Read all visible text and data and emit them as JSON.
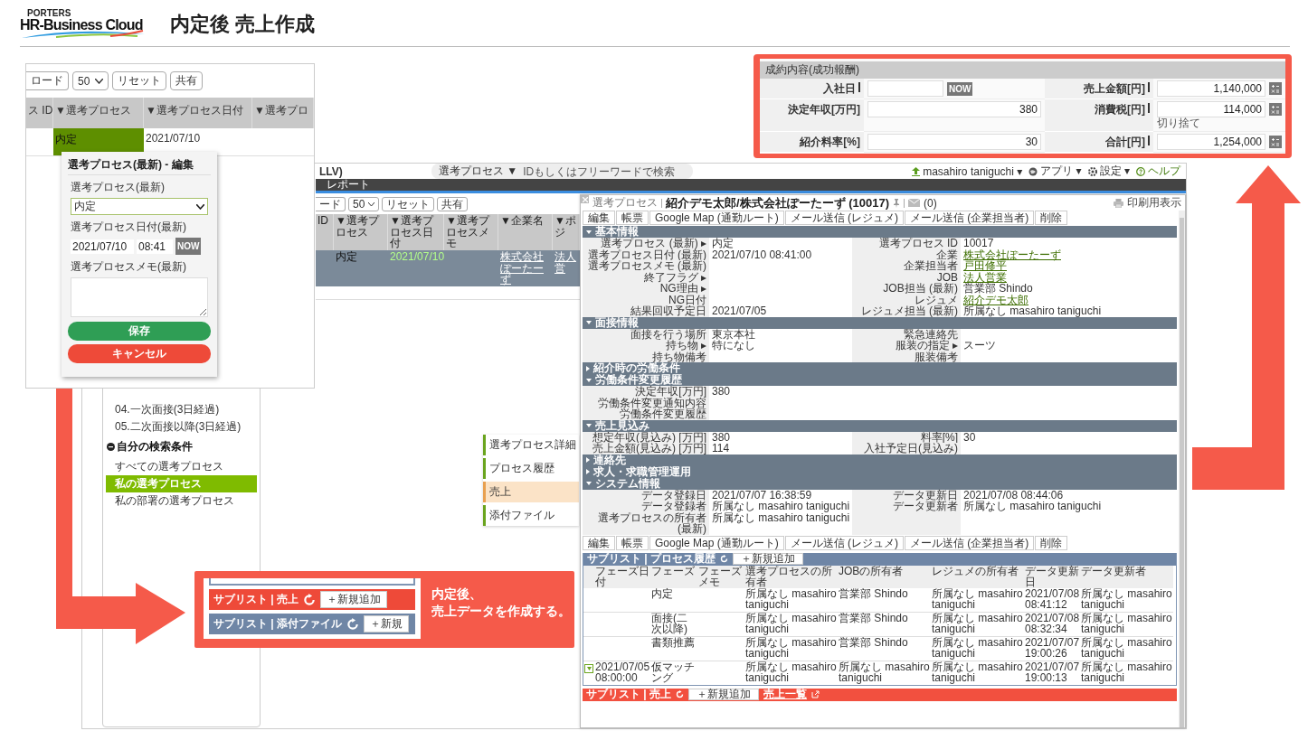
{
  "header": {
    "brand_top": "PORTERS",
    "brand": "HR-Business Cloud",
    "title": "内定後 売上作成"
  },
  "list_panel": {
    "toolbar": [
      {
        "kind": "button",
        "label": "ロード"
      },
      {
        "kind": "select",
        "label": "50"
      },
      {
        "kind": "button",
        "label": "リセット"
      },
      {
        "kind": "button",
        "label": "共有"
      }
    ],
    "columns": [
      "ス ID",
      "▼選考プロセス",
      "▼選考プロセス日付",
      "▼選考プロ"
    ],
    "row": {
      "process": "内定",
      "date": "2021/07/10"
    },
    "popup": {
      "title": "選考プロセス(最新) - 編集",
      "process_label": "選考プロセス(最新)",
      "process_value": "内定",
      "date_label": "選考プロセス日付(最新)",
      "date_value": "2021/07/10",
      "time_value": "08:41",
      "now_button": "NOW",
      "memo_label": "選考プロセスメモ(最新)",
      "save_button": "保存",
      "cancel_button": "キャンセル"
    }
  },
  "app": {
    "title_fragment": "LLV)",
    "search": {
      "scope": "選考プロセス ▼",
      "placeholder": "IDもしくはフリーワードで検索"
    },
    "user_menu": [
      {
        "kind": "user",
        "label": "masahiro taniguchi ▾"
      },
      {
        "kind": "apps",
        "label": "アプリ ▾"
      },
      {
        "kind": "settings",
        "label": "設定 ▾"
      },
      {
        "kind": "help",
        "label": "ヘルプ"
      }
    ],
    "menu": [
      "レポート"
    ],
    "toolbar": [
      {
        "kind": "button",
        "label": "ード"
      },
      {
        "kind": "select",
        "label": "50"
      },
      {
        "kind": "button",
        "label": "リセット"
      },
      {
        "kind": "button",
        "label": "共有"
      }
    ],
    "columns": [
      "ID",
      "▼選考プロセス",
      "▼選考プロセス日付",
      "▼選考プロセスメモ",
      "▼企業名",
      "▼ポジ"
    ],
    "row": {
      "process": "内定",
      "date": "2021/07/10",
      "company": "株式会社ぽーたーず",
      "position": "法人営"
    },
    "sidebar": {
      "groups": [
        {
          "items": [
            {
              "label": "04.一次面接(3日経過)",
              "selected": false
            },
            {
              "label": "05.二次面接以降(3日経過)",
              "selected": false
            }
          ]
        },
        {
          "heading": "自分の検索条件",
          "items": [
            {
              "label": "すべての選考プロセス",
              "selected": false
            },
            {
              "label": "私の選考プロセス",
              "selected": true
            },
            {
              "label": "私の部署の選考プロセス",
              "selected": false
            }
          ]
        }
      ]
    },
    "side_tabs": [
      {
        "label": "選考プロセス詳細",
        "selected": false
      },
      {
        "label": "プロセス履歴",
        "selected": false
      },
      {
        "label": "売上",
        "selected": true
      },
      {
        "label": "添付ファイル",
        "selected": false
      }
    ]
  },
  "detail": {
    "category": "選考プロセス",
    "title": "紹介デモ太郎/株式会社ぽーたーず (10017)",
    "mail_count": "(0)",
    "print": "印刷用表示",
    "actions": [
      "編集",
      "帳票",
      "Google Map (通勤ルート)",
      "メール送信 (レジュメ)",
      "メール送信 (企業担当者)",
      "削除"
    ],
    "sections": [
      {
        "title": "基本情報",
        "expanded": true,
        "rows": [
          {
            "kind": "pair",
            "cells": [
              {
                "label": "選考プロセス (最新) ▸",
                "value": "内定"
              },
              {
                "label": "選考プロセス ID",
                "value": "10017"
              }
            ]
          },
          {
            "kind": "pair",
            "cells": [
              {
                "label": "選考プロセス日付 (最新)",
                "value": "2021/07/10 08:41:00"
              },
              {
                "label": "企業",
                "value": "株式会社ぽーたーず",
                "link": true
              }
            ]
          },
          {
            "kind": "pair",
            "cells": [
              {
                "label": "選考プロセスメモ (最新)"
              },
              {
                "label": "企業担当者",
                "value": "戸田修平",
                "link": true
              }
            ]
          },
          {
            "kind": "pair",
            "cells": [
              {
                "label": "終了フラグ ▸"
              },
              {
                "label": "JOB",
                "value": "法人営業",
                "link": true
              }
            ]
          },
          {
            "kind": "pair",
            "cells": [
              {
                "label": "NG理由 ▸"
              },
              {
                "label": "JOB担当 (最新)",
                "value": "営業部 Shindo"
              }
            ]
          },
          {
            "kind": "pair",
            "cells": [
              {
                "label": "NG日付"
              },
              {
                "label": "レジュメ",
                "value": "紹介デモ太郎",
                "link": true
              }
            ]
          },
          {
            "kind": "pair",
            "cells": [
              {
                "label": "結果回収予定日",
                "value": "2021/07/05"
              },
              {
                "label": "レジュメ担当 (最新)",
                "value": "所属なし masahiro taniguchi"
              }
            ]
          }
        ]
      },
      {
        "title": "面接情報",
        "expanded": true,
        "rows": [
          {
            "kind": "pair",
            "cells": [
              {
                "label": "面接を行う場所",
                "value": "東京本社"
              },
              {
                "label": "緊急連絡先"
              }
            ]
          },
          {
            "kind": "pair",
            "cells": [
              {
                "label": "持ち物 ▸",
                "value": "特になし"
              },
              {
                "label": "服装の指定 ▸",
                "value": "スーツ"
              }
            ]
          },
          {
            "kind": "pair",
            "cells": [
              {
                "label": "持ち物備考"
              },
              {
                "label": "服装備考"
              }
            ]
          }
        ]
      },
      {
        "title": "紹介時の労働条件",
        "expanded": false
      },
      {
        "title": "労働条件変更履歴",
        "expanded": true,
        "rows": [
          {
            "kind": "wide",
            "cells": [
              {
                "label": "決定年収[万円]",
                "value": "380"
              }
            ]
          },
          {
            "kind": "wide",
            "cells": [
              {
                "label": "労働条件変更通知内容"
              }
            ]
          },
          {
            "kind": "wide",
            "cells": [
              {
                "label": "労働条件変更履歴"
              }
            ]
          }
        ]
      },
      {
        "title": "売上見込み",
        "expanded": true,
        "rows": [
          {
            "kind": "pair",
            "cells": [
              {
                "label": "想定年収(見込み) [万円]",
                "value": "380"
              },
              {
                "label": "料率[%]",
                "value": "30"
              }
            ]
          },
          {
            "kind": "pair",
            "cells": [
              {
                "label": "売上金額(見込み) [万円]",
                "value": "114"
              },
              {
                "label": "入社予定日(見込み)"
              }
            ]
          }
        ]
      },
      {
        "title": "連絡先",
        "expanded": false
      },
      {
        "title": "求人・求職管理運用",
        "expanded": false
      },
      {
        "title": "システム情報",
        "expanded": true,
        "rows": [
          {
            "kind": "pair",
            "cells": [
              {
                "label": "データ登録日",
                "value": "2021/07/07 16:38:59"
              },
              {
                "label": "データ更新日",
                "value": "2021/07/08 08:44:06"
              }
            ]
          },
          {
            "kind": "pair",
            "cells": [
              {
                "label": "データ登録者",
                "value": "所属なし masahiro taniguchi"
              },
              {
                "label": "データ更新者",
                "value": "所属なし masahiro taniguchi"
              }
            ]
          },
          {
            "kind": "pair",
            "cells": [
              {
                "label": "選考プロセスの所有者 (最新)",
                "value": "所属なし masahiro taniguchi"
              }
            ]
          }
        ]
      }
    ],
    "actions_bottom": [
      "編集",
      "帳票",
      "Google Map (通勤ルート)",
      "メール送信 (レジュメ)",
      "メール送信 (企業担当者)",
      "削除"
    ],
    "history": {
      "title": "サブリスト | プロセス履歴",
      "add_button": "＋新規追加",
      "columns": [
        "フェーズ日付",
        "フェーズ",
        "フェーズメモ",
        "選考プロセスの所有者",
        "JOBの所有者",
        "レジュメの所有者",
        "データ更新日",
        "データ更新者"
      ],
      "rows": [
        {
          "phase": "内定",
          "owner": "所属なし masahiro taniguchi",
          "job_owner": "営業部 Shindo",
          "resume_owner": "所属なし masahiro taniguchi",
          "updated": "2021/07/08 08:41:12",
          "updater": "所属なし masahiro taniguchi"
        },
        {
          "phase": "面接(二次以降)",
          "owner": "所属なし masahiro taniguchi",
          "job_owner": "営業部 Shindo",
          "resume_owner": "所属なし masahiro taniguchi",
          "updated": "2021/07/08 08:32:34",
          "updater": "所属なし masahiro taniguchi"
        },
        {
          "phase": "書類推薦",
          "owner": "所属なし masahiro taniguchi",
          "job_owner": "営業部 Shindo",
          "resume_owner": "所属なし masahiro taniguchi",
          "updated": "2021/07/07 19:00:26",
          "updater": "所属なし masahiro taniguchi"
        },
        {
          "toggle": true,
          "date": "2021/07/05 08:00:00",
          "phase": "仮マッチング",
          "owner": "所属なし masahiro taniguchi",
          "job_owner": "所属なし masahiro taniguchi",
          "resume_owner": "所属なし masahiro taniguchi",
          "updated": "2021/07/07 19:00:13",
          "updater": "所属なし masahiro taniguchi"
        }
      ]
    },
    "sales": {
      "title": "サブリスト | 売上",
      "add_button": "＋新規追加",
      "list_link": "売上一覧"
    }
  },
  "callout": {
    "sublists": [
      {
        "kind": "sales",
        "title": "サブリスト | 売上",
        "button": "＋新規追加"
      },
      {
        "kind": "attachments",
        "title": "サブリスト | 添付ファイル",
        "button": "＋新規"
      }
    ],
    "text_lines": [
      "内定後、",
      "売上データを作成する。"
    ]
  },
  "success_fee": {
    "title": "成約内容(成功報酬)",
    "fields": [
      {
        "kind": "date",
        "label": "入社日",
        "required": true,
        "button": "NOW"
      },
      {
        "kind": "calc",
        "label": "売上金額[円]",
        "required": true,
        "value": "1,140,000"
      },
      {
        "kind": "number",
        "label": "決定年収[万円]",
        "required": false,
        "value": "380"
      },
      {
        "kind": "calc",
        "label": "消費税[円]",
        "required": true,
        "value": "114,000",
        "note": "切り捨て"
      },
      {
        "kind": "number",
        "label": "紹介料率[%]",
        "required": false,
        "value": "30"
      },
      {
        "kind": "calc",
        "label": "合計[円]",
        "required": true,
        "value": "1,254,000"
      }
    ]
  }
}
